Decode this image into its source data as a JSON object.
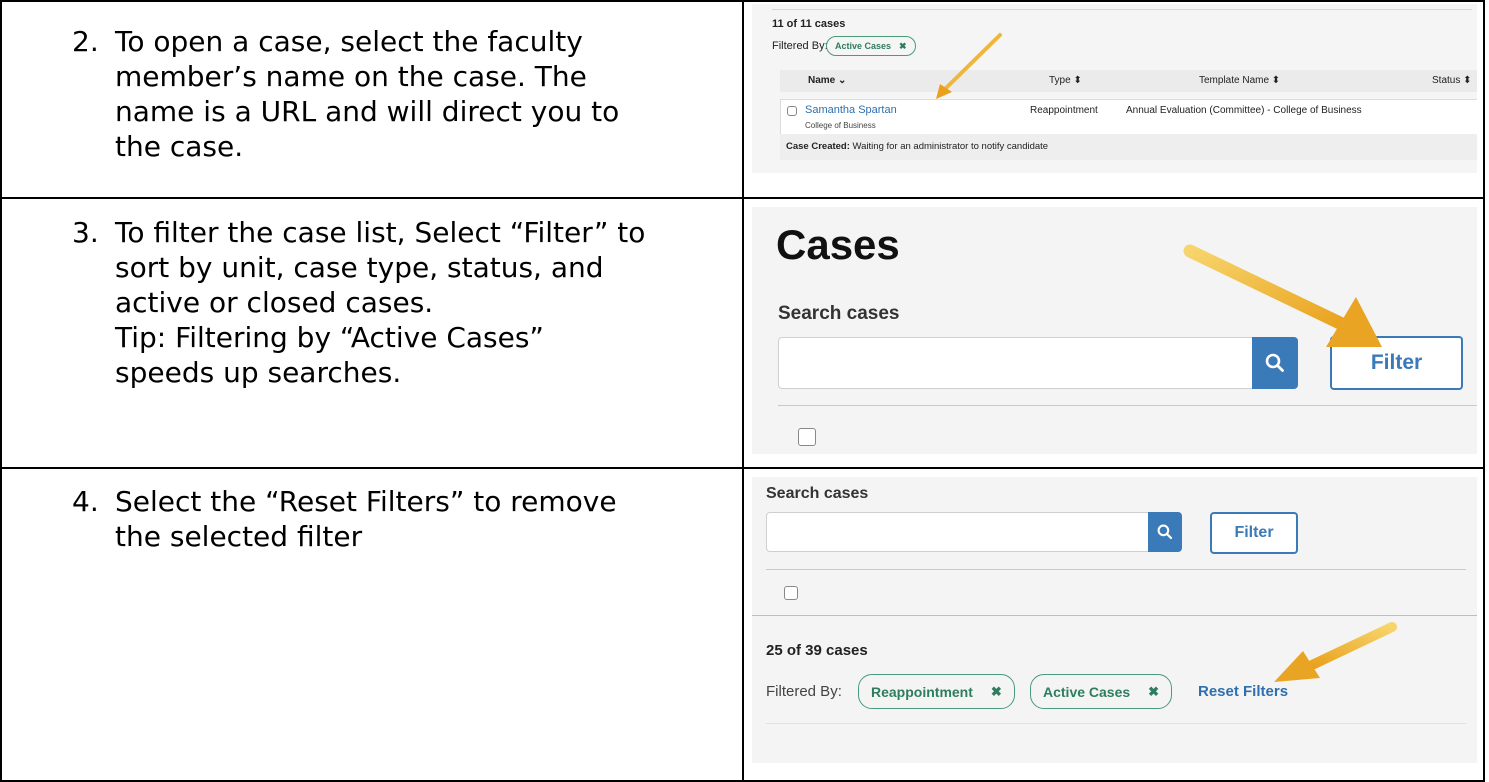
{
  "steps": [
    {
      "number": "2.",
      "lines": [
        "To open a case, select the faculty",
        "member’s name on the case. The",
        "name is a URL and will direct you to",
        "the case."
      ],
      "screenshot": {
        "count_label": "11 of 11 cases",
        "filtered_by_label": "Filtered By:",
        "chip_label": "Active Cases",
        "chip_remove": "✖",
        "columns": [
          "Name ⌄",
          "Type ⬍",
          "Template Name ⬍",
          "Status ⬍"
        ],
        "row": {
          "name": "Samantha Spartan",
          "unit": "College of Business",
          "type": "Reappointment",
          "template": "Annual Evaluation (Committee) - College of Business"
        },
        "status_bold": "Case Created:",
        "status_text": " Waiting for an administrator to notify candidate"
      }
    },
    {
      "number": "3.",
      "lines": [
        "To filter the case list, Select “Filter” to",
        "sort by unit, case type, status, and",
        "active or closed cases.",
        "Tip: Filtering by “Active Cases”",
        "speeds up searches."
      ],
      "screenshot": {
        "heading": "Cases",
        "search_label": "Search cases",
        "search_value": "",
        "filter_button": "Filter"
      }
    },
    {
      "number": "4.",
      "lines": [
        "Select the “Reset Filters” to remove",
        "the selected filter"
      ],
      "screenshot": {
        "search_label": "Search cases",
        "search_value": "",
        "filter_button": "Filter",
        "count_label": "25 of 39 cases",
        "filtered_by_label": "Filtered By:",
        "chips": [
          {
            "label": "Reappointment",
            "remove": "✖"
          },
          {
            "label": "Active Cases",
            "remove": "✖"
          }
        ],
        "reset_link": "Reset Filters"
      }
    }
  ],
  "colors": {
    "link": "#2f6fae",
    "chip": "#2e7d5f",
    "arrow": "#f2b533",
    "button": "#3b7ab8"
  },
  "icons": [
    "search-icon",
    "arrow-annotation-icon",
    "remove-filter-icon",
    "checkbox-icon",
    "sort-icon"
  ]
}
